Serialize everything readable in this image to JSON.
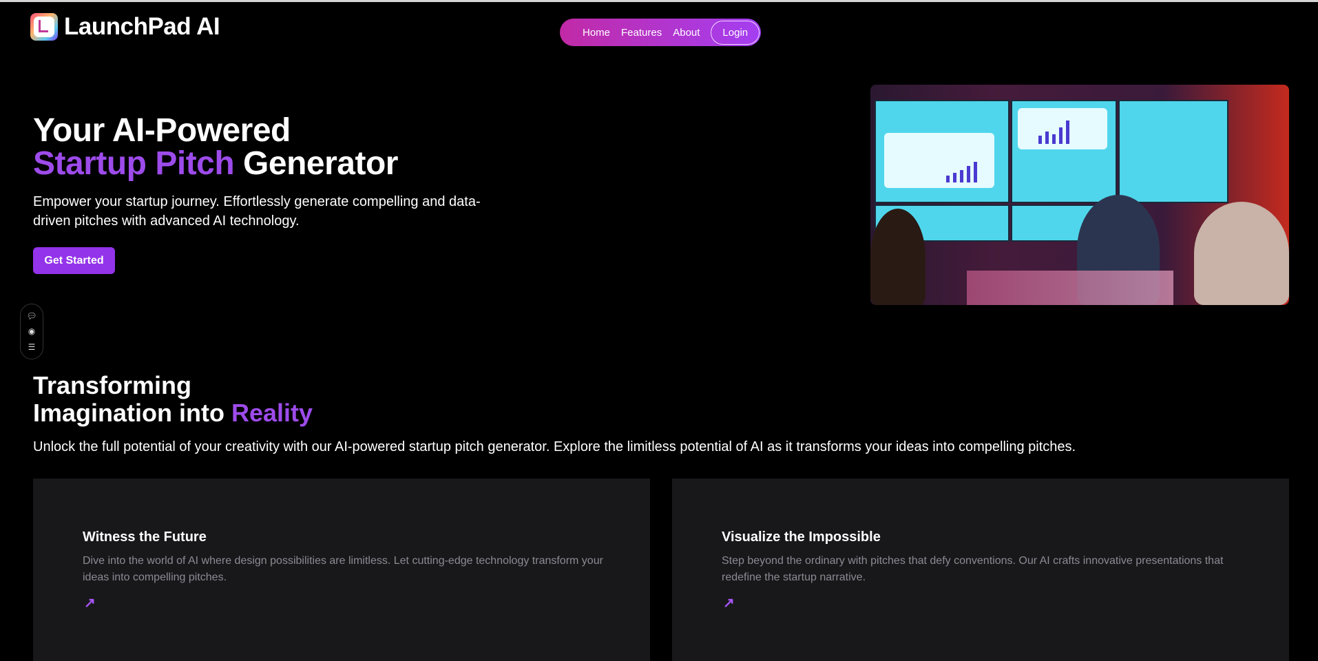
{
  "brand": {
    "name": "LaunchPad AI"
  },
  "nav": {
    "items": [
      "Home",
      "Features",
      "About"
    ],
    "login": "Login"
  },
  "hero": {
    "title_line1": "Your AI-Powered",
    "title_highlight": "Startup Pitch",
    "title_rest": "Generator",
    "description": "Empower your startup journey. Effortlessly generate compelling and data-driven pitches with advanced AI technology.",
    "cta": "Get Started"
  },
  "section": {
    "title_line1": "Transforming",
    "title_line2_prefix": "Imagination into",
    "title_highlight": "Reality",
    "description": "Unlock the full potential of your creativity with our AI-powered startup pitch generator. Explore the limitless potential of AI as it transforms your ideas into compelling pitches."
  },
  "cards": [
    {
      "title": "Witness the Future",
      "description": "Dive into the world of AI where design possibilities are limitless. Let cutting-edge technology transform your ideas into compelling pitches.",
      "arrow": "↗"
    },
    {
      "title": "Visualize the Impossible",
      "description": "Step beyond the ordinary with pitches that defy conventions. Our AI crafts innovative presentations that redefine the startup narrative.",
      "arrow": "↗"
    }
  ],
  "colors": {
    "accent": "#9333ea",
    "highlight": "#9d4bea",
    "card_bg": "#18181b",
    "nav_from": "#c12aa6",
    "nav_to": "#a43ff2"
  }
}
